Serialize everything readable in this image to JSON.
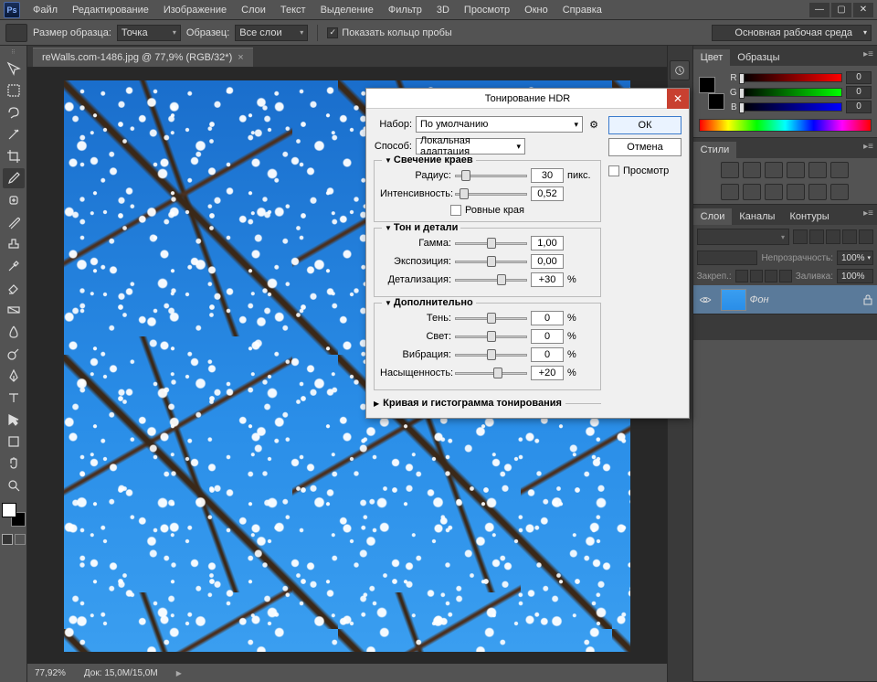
{
  "menubar": [
    "Файл",
    "Редактирование",
    "Изображение",
    "Слои",
    "Текст",
    "Выделение",
    "Фильтр",
    "3D",
    "Просмотр",
    "Окно",
    "Справка"
  ],
  "options": {
    "sample_label": "Размер образца:",
    "sample_value": "Точка",
    "sample2_label": "Образец:",
    "sample2_value": "Все слои",
    "ring_label": "Показать кольцо пробы",
    "workspace": "Основная рабочая среда"
  },
  "doc_tab": "reWalls.com-1486.jpg @ 77,9% (RGB/32*)",
  "status": {
    "zoom": "77,92%",
    "doc_label": "Док:",
    "doc_value": "15,0M/15,0M"
  },
  "color_panel": {
    "tabs": [
      "Цвет",
      "Образцы"
    ],
    "channels": [
      {
        "label": "R",
        "val": "0"
      },
      {
        "label": "G",
        "val": "0"
      },
      {
        "label": "B",
        "val": "0"
      }
    ]
  },
  "styles_panel": {
    "tab": "Стили"
  },
  "layers_panel": {
    "tabs": [
      "Слои",
      "Каналы",
      "Контуры"
    ],
    "opacity_label": "Непрозрачность:",
    "opacity_value": "100%",
    "fill_label": "Заливка:",
    "fill_value": "100%",
    "lock_label": "Закреп.:",
    "layer_name": "Фон"
  },
  "dialog": {
    "title": "Тонирование HDR",
    "preset_label": "Набор:",
    "preset_value": "По умолчанию",
    "method_label": "Способ:",
    "method_value": "Локальная адаптация",
    "ok": "ОК",
    "cancel": "Отмена",
    "preview": "Просмотр",
    "sections": {
      "edge_glow": {
        "title": "Свечение краев",
        "radius_label": "Радиус:",
        "radius_value": "30",
        "radius_unit": "пикс.",
        "strength_label": "Интенсивность:",
        "strength_value": "0,52",
        "smooth_label": "Ровные края"
      },
      "tone_detail": {
        "title": "Тон и детали",
        "gamma_label": "Гамма:",
        "gamma_value": "1,00",
        "exposure_label": "Экспозиция:",
        "exposure_value": "0,00",
        "detail_label": "Детализация:",
        "detail_value": "+30",
        "detail_unit": "%"
      },
      "advanced": {
        "title": "Дополнительно",
        "shadow_label": "Тень:",
        "shadow_value": "0",
        "highlight_label": "Свет:",
        "highlight_value": "0",
        "vibrance_label": "Вибрация:",
        "vibrance_value": "0",
        "saturation_label": "Насыщенность:",
        "saturation_value": "+20"
      },
      "curve": {
        "title": "Кривая и гистограмма тонирования"
      }
    }
  }
}
